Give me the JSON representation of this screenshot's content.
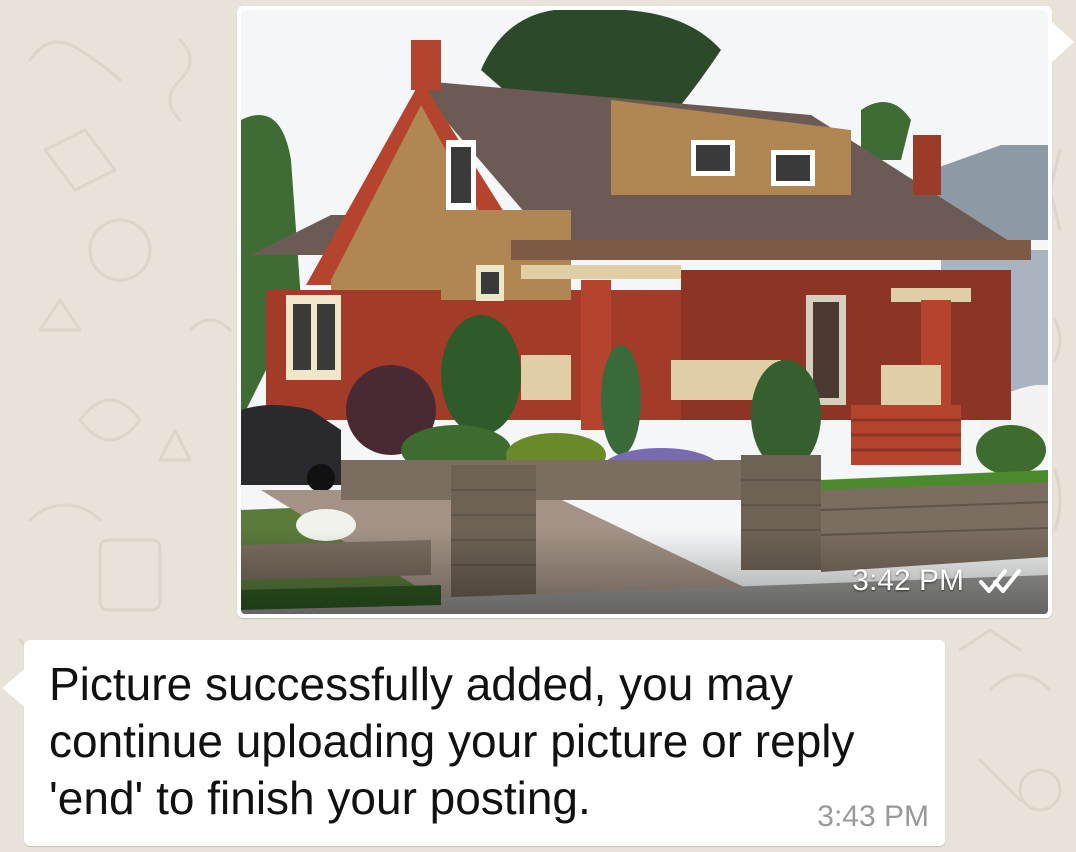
{
  "chat": {
    "messages": [
      {
        "direction": "outgoing",
        "type": "image",
        "time": "3:42 PM",
        "status_icon": "double-check-icon",
        "image_subject": "craftsman-house-photo"
      },
      {
        "direction": "incoming",
        "type": "text",
        "text": "Picture successfully added, you may continue uploading your picture or reply 'end' to finish your posting.",
        "time": "3:43 PM"
      }
    ]
  },
  "colors": {
    "wallpaper": "#e8e2d8",
    "bubble": "#ffffff",
    "timestamp_incoming": "#999999",
    "timestamp_on_image": "#ffffff"
  }
}
